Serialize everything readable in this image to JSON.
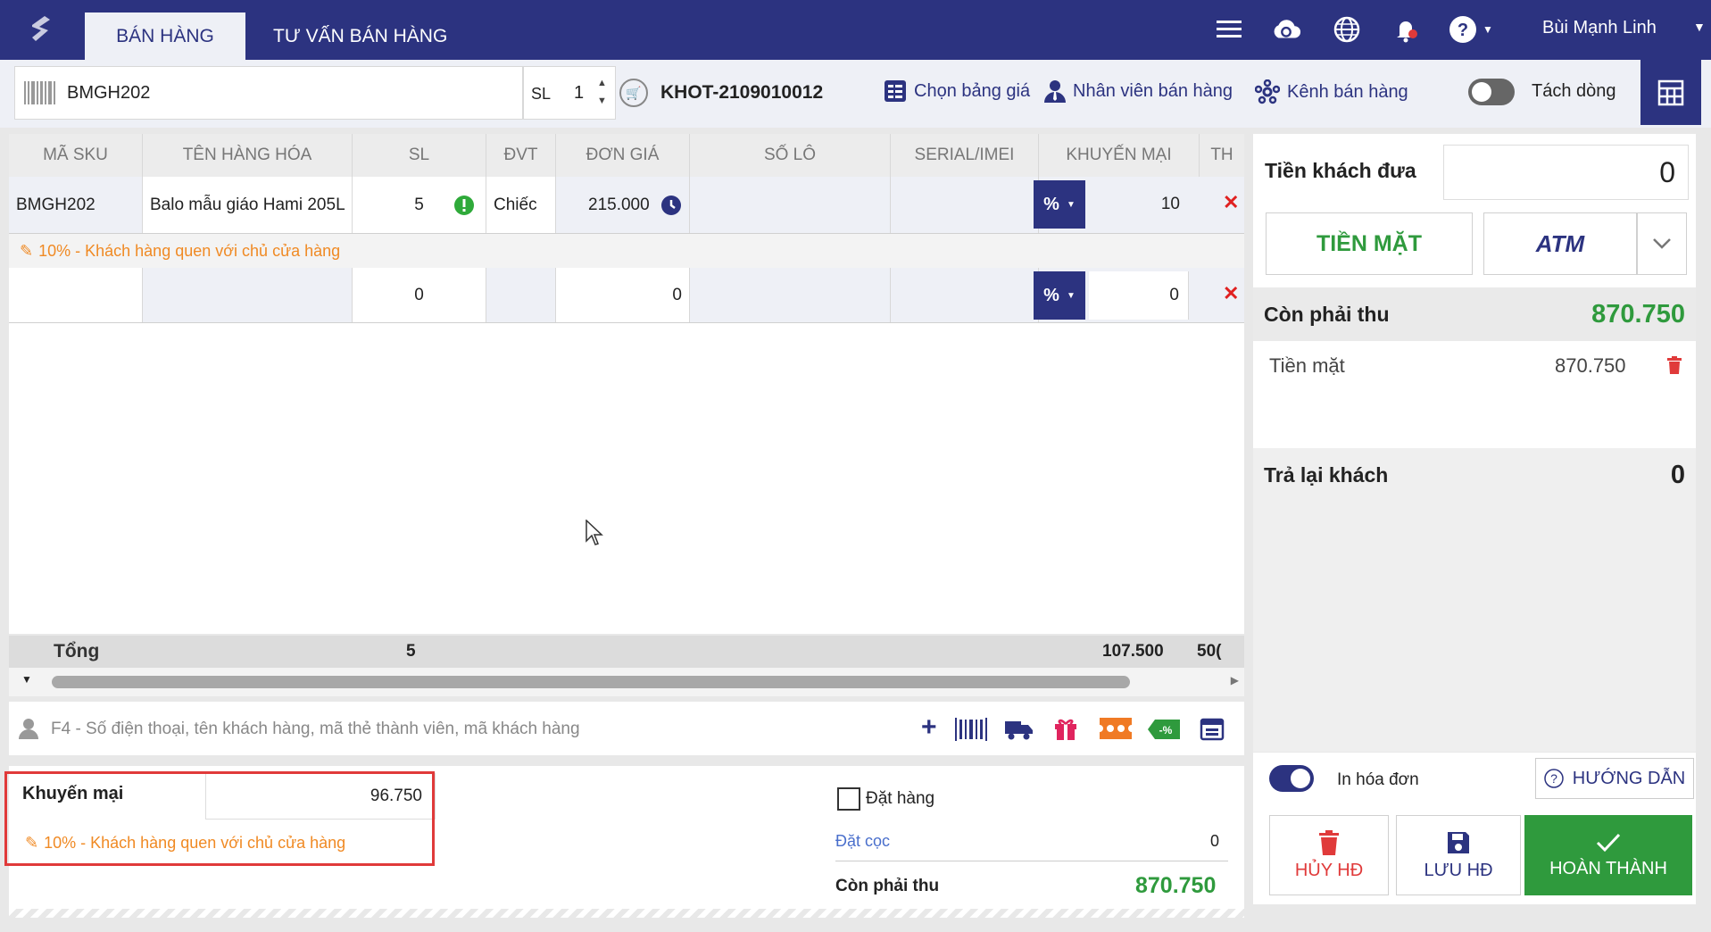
{
  "colors": {
    "brand": "#2c3380",
    "green": "#2f9a3d",
    "orange": "#f08a24",
    "red": "#e03a3a"
  },
  "topbar": {
    "tabs": [
      {
        "label": "BÁN HÀNG"
      },
      {
        "label": "TƯ VẤN BÁN HÀNG"
      }
    ],
    "user": "Bùi Mạnh Linh",
    "icons": [
      "menu-icon",
      "cloud-sync-icon",
      "globe-icon",
      "bell-icon",
      "help-icon"
    ]
  },
  "toolbar": {
    "barcode_value": "BMGH202",
    "sl_label": "SL",
    "sl_value": "1",
    "store_code": "KHOT-2109010012",
    "price_list": "Chọn bảng giá",
    "staff": "Nhân viên bán hàng",
    "channel": "Kênh bán hàng",
    "split_label": "Tách dòng"
  },
  "table": {
    "headers": [
      "MÃ SKU",
      "TÊN HÀNG HÓA",
      "SL",
      "ĐVT",
      "ĐƠN GIÁ",
      "SỐ LÔ",
      "SERIAL/IMEI",
      "KHUYẾN MẠI",
      "TH"
    ],
    "row1": {
      "sku": "BMGH202",
      "name": "Balo mẫu giáo Hami 205L",
      "qty": "5",
      "unit": "Chiếc",
      "price": "215.000",
      "discount_type": "%",
      "discount": "10"
    },
    "row1_note": "10% - Khách hàng quen với chủ cửa hàng",
    "row2": {
      "qty": "0",
      "price": "0",
      "discount_type": "%",
      "discount": "0"
    },
    "total_label": "Tổng",
    "total_qty": "5",
    "total_discount": "107.500",
    "total_th": "50("
  },
  "customer": {
    "placeholder": "F4 - Số điện thoại, tên khách hàng, mã thẻ thành viên, mã khách hàng"
  },
  "summary": {
    "promo_label": "Khuyến mại",
    "promo_value": "96.750",
    "promo_note": "10% - Khách hàng quen với chủ cửa hàng",
    "order_label": "Đặt hàng",
    "deposit_label": "Đặt cọc",
    "deposit_value": "0",
    "due_label": "Còn phải thu",
    "due_value": "870.750"
  },
  "payment": {
    "given_label": "Tiền khách đưa",
    "given_value": "0",
    "cash_btn": "TIỀN MẶT",
    "atm_btn": "ATM",
    "due_label": "Còn phải thu",
    "due_value": "870.750",
    "cash_line_label": "Tiền mặt",
    "cash_line_value": "870.750",
    "change_label": "Trả lại khách",
    "change_value": "0",
    "print_label": "In hóa đơn",
    "guide_label": "HƯỚNG DẪN",
    "cancel_label": "HỦY HĐ",
    "save_label": "LƯU HĐ",
    "finish_label": "HOÀN THÀNH"
  }
}
